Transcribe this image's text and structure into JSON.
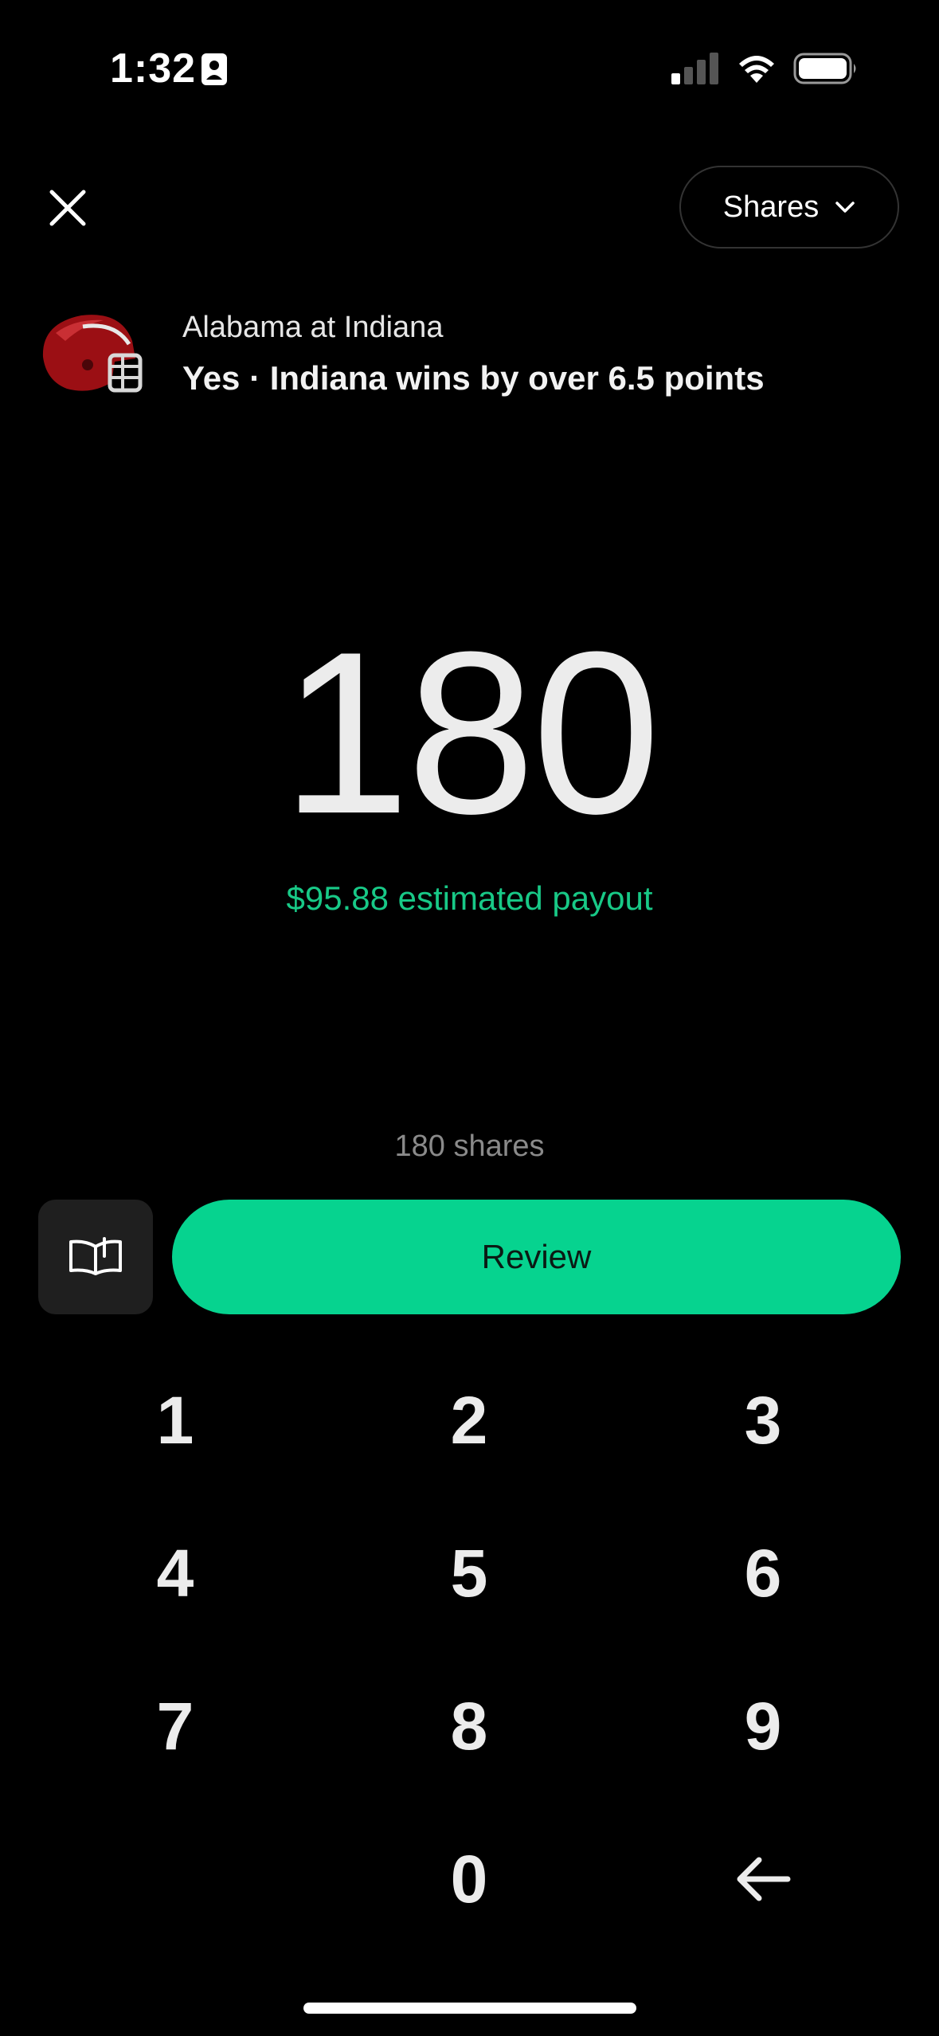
{
  "status_bar": {
    "time": "1:32",
    "icons": [
      "id-card-icon",
      "cellular-signal-icon",
      "wifi-icon",
      "battery-icon"
    ]
  },
  "top_bar": {
    "close_icon": "close-icon",
    "mode_dropdown": {
      "label": "Shares",
      "icon": "chevron-down-icon"
    }
  },
  "market": {
    "subtitle": "Alabama at Indiana",
    "title": "Yes · Indiana wins by over 6.5 points",
    "image": "football-helmet-icon"
  },
  "order": {
    "amount": "180",
    "payout": "$95.88 estimated payout",
    "shares_label": "180 shares"
  },
  "actions": {
    "guide_icon": "open-book-icon",
    "review_label": "Review"
  },
  "keypad": {
    "keys": [
      "1",
      "2",
      "3",
      "4",
      "5",
      "6",
      "7",
      "8",
      "9",
      "0"
    ],
    "backspace_icon": "backspace-arrow-icon"
  },
  "colors": {
    "accent": "#06d38f",
    "payout_text": "#18c987",
    "background": "#000000"
  }
}
